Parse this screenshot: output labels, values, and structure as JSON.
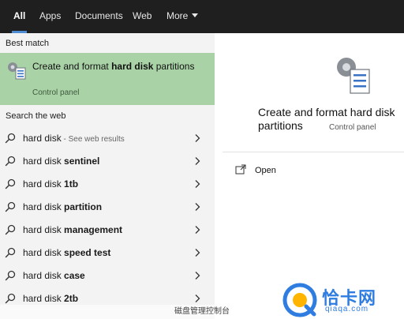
{
  "nav": {
    "tabs": [
      {
        "label": "All",
        "active": true
      },
      {
        "label": "Apps"
      },
      {
        "label": "Documents"
      },
      {
        "label": "Web"
      },
      {
        "label": "More"
      }
    ]
  },
  "best_match": {
    "heading": "Best match",
    "title_prefix": "Create and format ",
    "title_bold": "hard disk",
    "title_suffix": " partitions",
    "subtitle": "Control panel",
    "icon": "control-panel-icon"
  },
  "web": {
    "heading": "Search the web",
    "results": [
      {
        "prefix": "hard disk",
        "bold": "",
        "hint": " - See web results"
      },
      {
        "prefix": "hard disk ",
        "bold": "sentinel",
        "hint": ""
      },
      {
        "prefix": "hard disk ",
        "bold": "1tb",
        "hint": ""
      },
      {
        "prefix": "hard disk ",
        "bold": "partition",
        "hint": ""
      },
      {
        "prefix": "hard disk ",
        "bold": "management",
        "hint": ""
      },
      {
        "prefix": "hard disk ",
        "bold": "speed test",
        "hint": ""
      },
      {
        "prefix": "hard disk ",
        "bold": "case",
        "hint": ""
      },
      {
        "prefix": "hard disk ",
        "bold": "2tb",
        "hint": ""
      }
    ]
  },
  "detail": {
    "title": "Create and format hard disk partitions",
    "subtitle": "Control panel",
    "action_open": "Open"
  },
  "caption": "磁盘管理控制台",
  "watermark": {
    "text": "恰卡网",
    "url": "qiaqa.com"
  },
  "colors": {
    "accent": "#4f8cd6",
    "selected": "#a9d2a6",
    "topbar": "#1f1f1f",
    "watermark": "#2f7de1"
  }
}
